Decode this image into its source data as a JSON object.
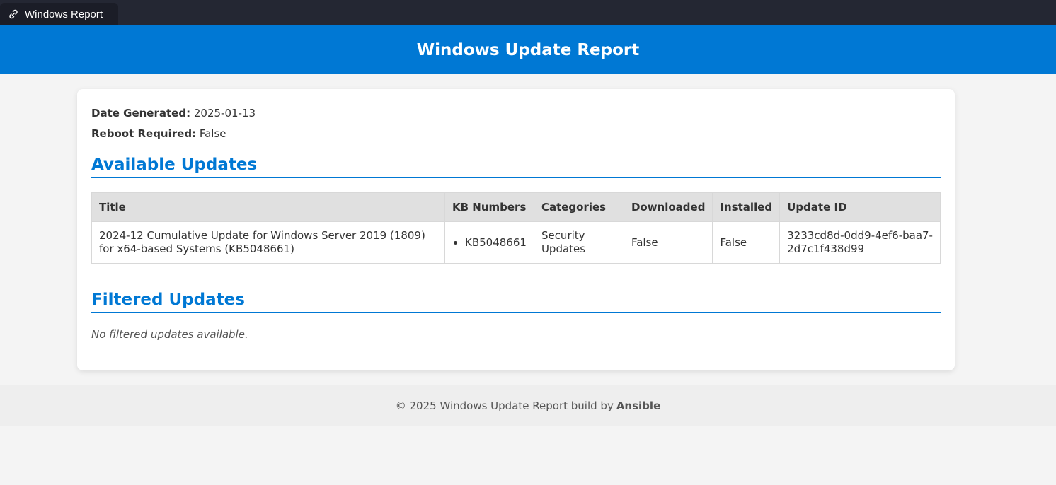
{
  "browser": {
    "tab_title": "Windows Report",
    "tab_icon": "link-icon"
  },
  "header": {
    "title": "Windows Update Report"
  },
  "meta": {
    "date_label": "Date Generated:",
    "date_value": "2025-01-13",
    "reboot_label": "Reboot Required:",
    "reboot_value": "False"
  },
  "available": {
    "heading": "Available Updates",
    "columns": [
      "Title",
      "KB Numbers",
      "Categories",
      "Downloaded",
      "Installed",
      "Update ID"
    ],
    "rows": [
      {
        "title": "2024-12 Cumulative Update for Windows Server 2019 (1809) for x64-based Systems (KB5048661)",
        "kb": "KB5048661",
        "categories": "Security Updates",
        "downloaded": "False",
        "installed": "False",
        "update_id": "3233cd8d-0dd9-4ef6-baa7-2d7c1f438d99"
      }
    ]
  },
  "filtered": {
    "heading": "Filtered Updates",
    "empty_text": "No filtered updates available."
  },
  "footer": {
    "text": "© 2025 Windows Update Report build by",
    "brand": "Ansible"
  },
  "colors": {
    "accent": "#0078d4",
    "browser_bar": "#242733",
    "background": "#f4f4f4"
  }
}
